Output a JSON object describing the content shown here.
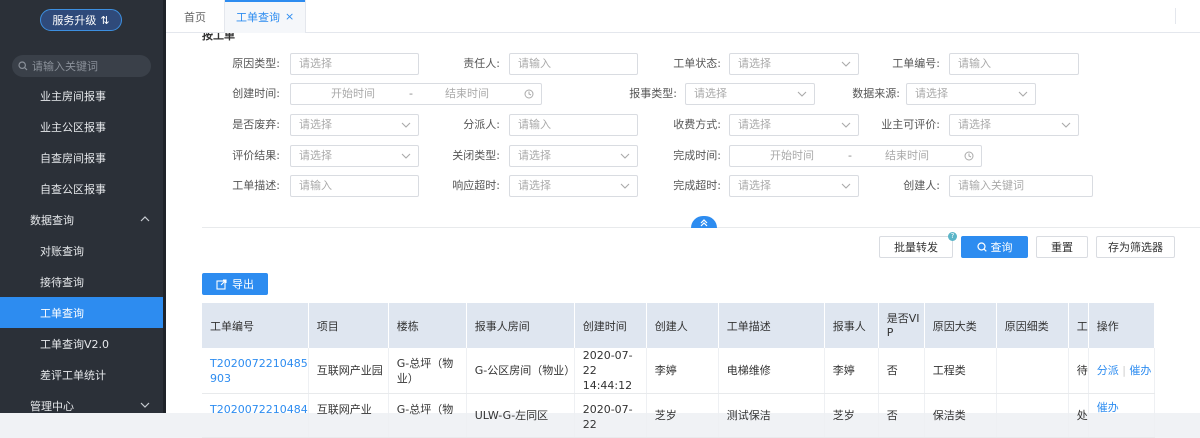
{
  "sidebar": {
    "upgrade_label": "服务升级",
    "search_placeholder": "请输入关键词",
    "items": [
      {
        "label": "业主房间报事"
      },
      {
        "label": "业主公区报事"
      },
      {
        "label": "自查房间报事"
      },
      {
        "label": "自查公区报事"
      }
    ],
    "group_data": "数据查询",
    "sub_items": [
      {
        "label": "对账查询"
      },
      {
        "label": "接待查询"
      },
      {
        "label": "工单查询"
      },
      {
        "label": "工单查询V2.0"
      },
      {
        "label": "差评工单统计"
      }
    ],
    "group_manage": "管理中心"
  },
  "tabs": {
    "home": "首页",
    "active": "工单查询",
    "close": "×"
  },
  "filters": {
    "section_title": "按工单",
    "reason_type": {
      "label": "原因类型:",
      "placeholder": "请选择"
    },
    "owner": {
      "label": "责任人:",
      "placeholder": "请输入"
    },
    "status": {
      "label": "工单状态:",
      "placeholder": "请选择"
    },
    "order_no": {
      "label": "工单编号:",
      "placeholder": "请输入"
    },
    "created_time": {
      "label": "创建时间:",
      "start": "开始时间",
      "sep": "-",
      "end": "结束时间"
    },
    "report_type": {
      "label": "报事类型:",
      "placeholder": "请选择"
    },
    "data_source": {
      "label": "数据来源:",
      "placeholder": "请选择"
    },
    "discarded": {
      "label": "是否废弃:",
      "placeholder": "请选择"
    },
    "dispatcher": {
      "label": "分派人:",
      "placeholder": "请输入"
    },
    "fee_method": {
      "label": "收费方式:",
      "placeholder": "请选择"
    },
    "owner_rate": {
      "label": "业主可评价:",
      "placeholder": "请选择"
    },
    "eval_result": {
      "label": "评价结果:",
      "placeholder": "请选择"
    },
    "close_type": {
      "label": "关闭类型:",
      "placeholder": "请选择"
    },
    "finish_time": {
      "label": "完成时间:",
      "start": "开始时间",
      "sep": "-",
      "end": "结束时间"
    },
    "description": {
      "label": "工单描述:",
      "placeholder": "请输入"
    },
    "response_timeout": {
      "label": "响应超时:",
      "placeholder": "请选择"
    },
    "finish_timeout": {
      "label": "完成超时:",
      "placeholder": "请选择"
    },
    "creator": {
      "label": "创建人:",
      "placeholder": "请输入关键词"
    }
  },
  "actions": {
    "batch_forward": "批量转发",
    "query": "查询",
    "reset": "重置",
    "save_filter": "存为筛选器",
    "help_badge": "?"
  },
  "table": {
    "export_label": "导出",
    "headers": [
      "工单编号",
      "项目",
      "楼栋",
      "报事人房间",
      "创建时间",
      "创建人",
      "工单描述",
      "报事人",
      "是否VIP",
      "原因大类",
      "原因细类",
      "工",
      "操作"
    ],
    "rows": [
      {
        "order_no": "T2020072210485903",
        "project": "互联网产业园",
        "building": "G-总坪（物业）",
        "room": "G-公区房间（物业）",
        "created": "2020-07-22 14:44:12",
        "creator": "李婷",
        "desc": "电梯维修",
        "reporter": "李婷",
        "vip": "否",
        "reason_major": "工程类",
        "reason_minor": "",
        "status": "待",
        "op_assign": "分派",
        "op_sep": "|",
        "op_urge": "催办"
      },
      {
        "order_no": "T2020072210484",
        "project": "互联网产业",
        "building": "G-总坪（物",
        "room": "ULW-G-左同区",
        "created": "2020-07-22",
        "creator": "芝岁",
        "desc": "测试保洁",
        "reporter": "芝岁",
        "vip": "否",
        "reason_major": "保洁类",
        "reason_minor": "",
        "status": "处",
        "op_assign": "",
        "op_sep": "",
        "op_urge": "催办"
      }
    ]
  }
}
